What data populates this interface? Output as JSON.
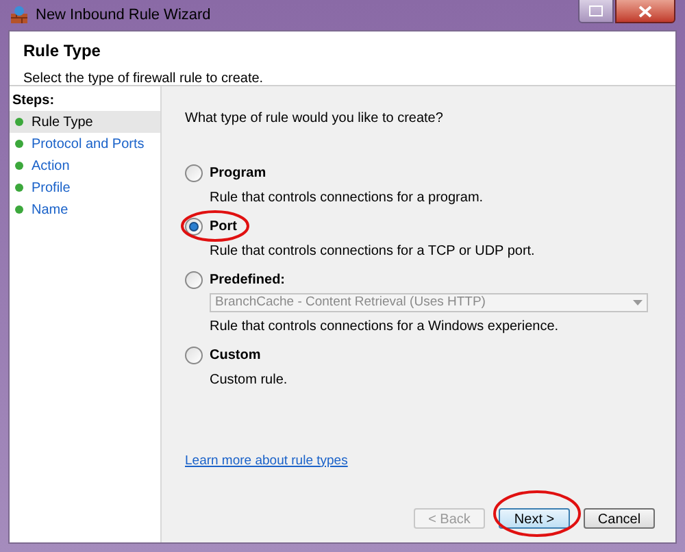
{
  "window": {
    "title": "New Inbound Rule Wizard"
  },
  "header": {
    "title": "Rule Type",
    "subtitle": "Select the type of firewall rule to create."
  },
  "steps": {
    "heading": "Steps:",
    "items": [
      {
        "label": "Rule Type",
        "selected": true
      },
      {
        "label": "Protocol and Ports",
        "selected": false
      },
      {
        "label": "Action",
        "selected": false
      },
      {
        "label": "Profile",
        "selected": false
      },
      {
        "label": "Name",
        "selected": false
      }
    ]
  },
  "question": "What type of rule would you like to create?",
  "options": [
    {
      "label": "Program",
      "description": "Rule that controls connections for a program.",
      "selected": false
    },
    {
      "label": "Port",
      "description": "Rule that controls connections for a TCP or UDP port.",
      "selected": true
    },
    {
      "label": "Predefined:",
      "description": "Rule that controls connections for a Windows experience.",
      "selected": false,
      "dropdown": {
        "value": "BranchCache - Content Retrieval (Uses HTTP)",
        "disabled": true
      }
    },
    {
      "label": "Custom",
      "description": "Custom rule.",
      "selected": false
    }
  ],
  "link": "Learn more about rule types",
  "buttons": [
    {
      "label": "< Back",
      "disabled": true,
      "default": false
    },
    {
      "label": "Next >",
      "disabled": false,
      "default": true
    },
    {
      "label": "Cancel",
      "disabled": false,
      "default": false
    }
  ]
}
